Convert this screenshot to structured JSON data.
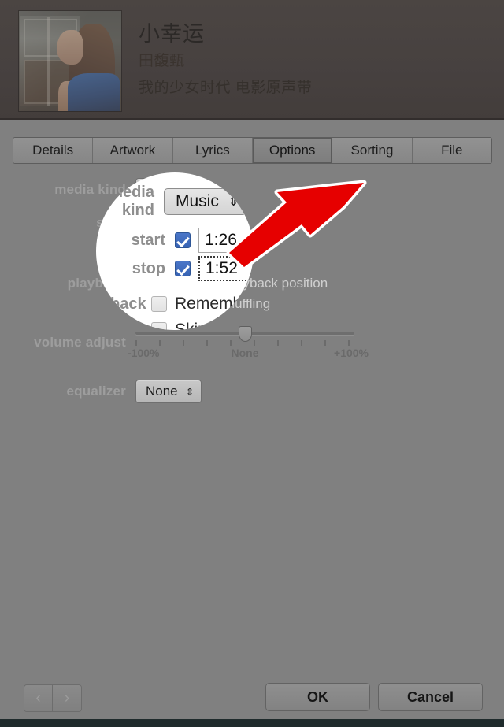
{
  "header": {
    "song_title": "小幸运",
    "artist": "田馥甄",
    "album": "我的少女时代 电影原声带",
    "artwork_alt": "album-artwork"
  },
  "tabs": [
    {
      "label": "Details",
      "active": false
    },
    {
      "label": "Artwork",
      "active": false
    },
    {
      "label": "Lyrics",
      "active": false
    },
    {
      "label": "Options",
      "active": true
    },
    {
      "label": "Sorting",
      "active": false
    },
    {
      "label": "File",
      "active": false
    }
  ],
  "options": {
    "media_kind_label": "media kind",
    "media_kind_value": "Music",
    "start_label": "start",
    "start_value": "1:26",
    "start_checked": true,
    "stop_label": "stop",
    "stop_value": "1:52",
    "stop_checked": true,
    "playback_label": "playback",
    "remember_position_label": "Remember playback position",
    "remember_position_checked": false,
    "skip_shuffling_label": "Skip when shuffling",
    "skip_shuffling_checked": false,
    "volume_label": "volume adjust",
    "volume_min_label": "-100%",
    "volume_mid_label": "None",
    "volume_max_label": "+100%",
    "volume_value": "None",
    "equalizer_label": "equalizer",
    "equalizer_value": "None",
    "chevron_glyph": "⇕"
  },
  "magnifier": {
    "media_kind_label": "media kind",
    "media_kind_value": "Music",
    "start_label": "start",
    "start_value": "1:26",
    "stop_label": "stop",
    "stop_value": "1:52",
    "playback_label": "playback",
    "remember_position_label": "Remember playba",
    "skip_shuffling_label": "Skip when shufflin",
    "chevron_glyph": "⇕"
  },
  "annotation": {
    "arrow_color": "#e60000",
    "arrow_outline": "#ffffff",
    "arrow_target": "stop-time-field"
  },
  "footer": {
    "prev_glyph": "‹",
    "next_glyph": "›",
    "ok_label": "OK",
    "cancel_label": "Cancel"
  },
  "colors": {
    "background": "#808080",
    "header": "#474140",
    "checkbox_blue": "#3763b4",
    "accent_red": "#e60000"
  }
}
